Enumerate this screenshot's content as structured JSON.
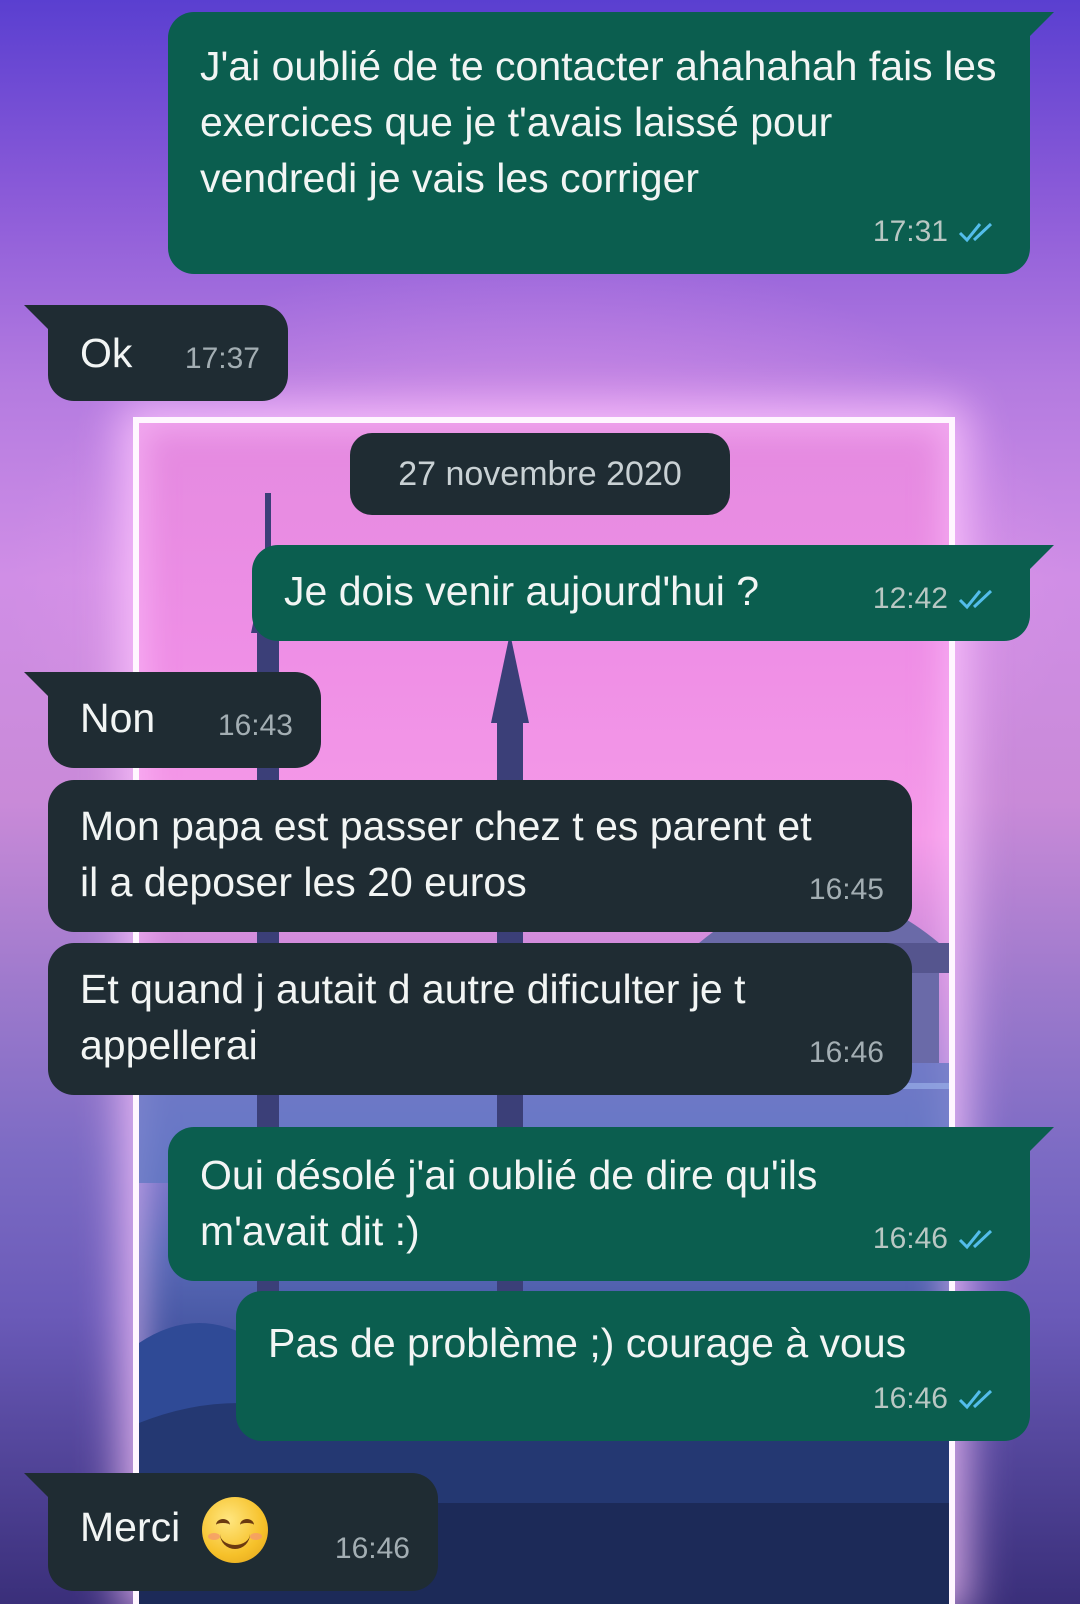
{
  "messages": [
    {
      "text": "J'ai oublié de te contacter ahahahah fais les exercices que je t'avais laissé pour vendredi je vais les corriger",
      "time": "17:31",
      "direction": "out",
      "status": "read"
    },
    {
      "text": "Ok",
      "time": "17:37",
      "direction": "in"
    },
    {
      "text": "Je dois venir aujourd'hui ?",
      "time": "12:42",
      "direction": "out",
      "status": "read"
    },
    {
      "text": "Non",
      "time": "16:43",
      "direction": "in"
    },
    {
      "text": "Mon papa est passer chez t es parent et il a deposer les 20 euros",
      "time": "16:45",
      "direction": "in"
    },
    {
      "text": "Et quand j autait d autre dificulter je t appellerai",
      "time": "16:46",
      "direction": "in"
    },
    {
      "text": "Oui désolé j'ai oublié de dire qu'ils m'avait dit :)",
      "time": "16:46",
      "direction": "out",
      "status": "read"
    },
    {
      "text": "Pas de problème ;) courage à vous",
      "time": "16:46",
      "direction": "out",
      "status": "read"
    },
    {
      "text": "Merci",
      "emoji": "smiling-face-icon",
      "time": "16:46",
      "direction": "in"
    }
  ],
  "date_separator": "27 novembre 2020",
  "colors": {
    "outgoing_bubble": "#0b5e4f",
    "incoming_bubble": "#1f2c33",
    "read_ticks": "#53bdeb"
  }
}
